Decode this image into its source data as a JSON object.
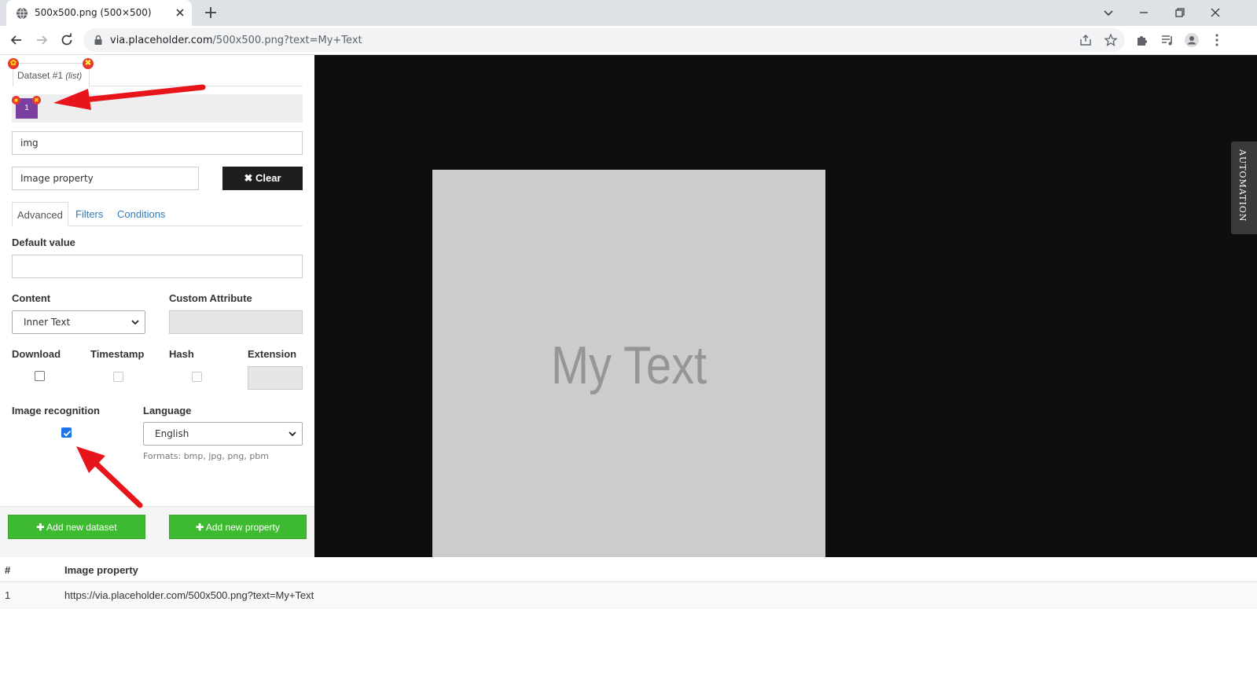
{
  "browser": {
    "tab_title": "500x500.png (500×500)",
    "url_host": "via.placeholder.com",
    "url_path": "/500x500.png?text=My+Text"
  },
  "panel": {
    "dataset_tab": "Dataset #1",
    "dataset_tab_type": "(list)",
    "selection_item": "1",
    "selector_value": "img",
    "property_name": "Image property",
    "clear_button": "Clear",
    "tabs": [
      "Advanced",
      "Filters",
      "Conditions"
    ],
    "default_value_label": "Default value",
    "default_value": "",
    "content_label": "Content",
    "content_value": "Inner Text",
    "custom_attribute_label": "Custom Attribute",
    "download_label": "Download",
    "timestamp_label": "Timestamp",
    "hash_label": "Hash",
    "extension_label": "Extension",
    "image_recognition_label": "Image recognition",
    "image_recognition_checked": true,
    "language_label": "Language",
    "language_value": "English",
    "formats_help": "Formats: bmp, jpg, png, pbm",
    "add_dataset_button": "Add new dataset",
    "add_property_button": "Add new property"
  },
  "viewer": {
    "image_text": "My Text",
    "automation_tab": "AUTOMATION"
  },
  "table": {
    "headers": [
      "#",
      "Image property"
    ],
    "rows": [
      [
        "1",
        "https://via.placeholder.com/500x500.png?text=My+Text"
      ]
    ]
  },
  "colors": {
    "accent_green": "#3dba2f",
    "selection_purple": "#7b3fa0",
    "arrow_red": "#e8141b"
  }
}
